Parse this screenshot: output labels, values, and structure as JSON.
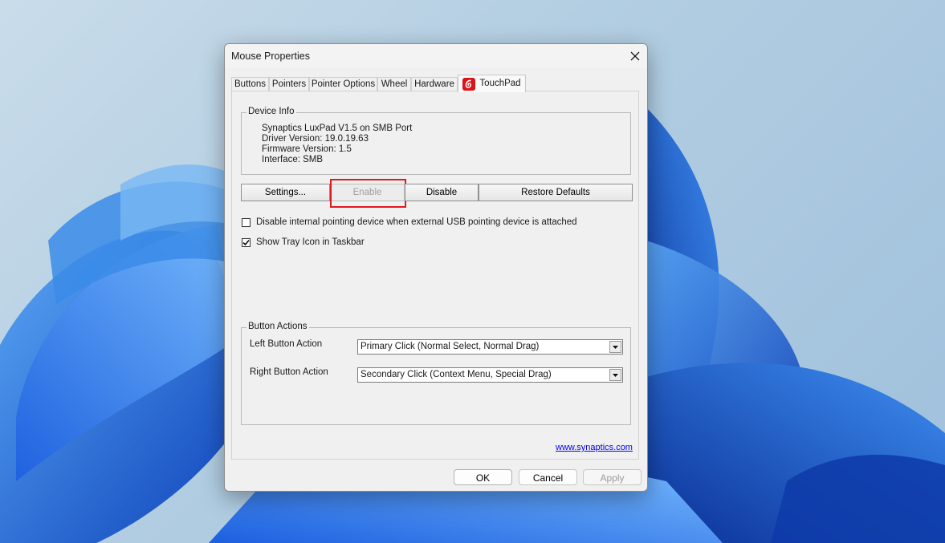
{
  "window": {
    "title": "Mouse Properties"
  },
  "tabs": [
    {
      "label": "Buttons"
    },
    {
      "label": "Pointers"
    },
    {
      "label": "Pointer Options"
    },
    {
      "label": "Wheel"
    },
    {
      "label": "Hardware"
    },
    {
      "label": "TouchPad",
      "active": true
    }
  ],
  "device_info": {
    "legend": "Device Info",
    "lines": [
      "Synaptics LuxPad V1.5 on SMB Port",
      "Driver Version: 19.0.19.63",
      "Firmware Version: 1.5",
      "Interface: SMB"
    ]
  },
  "actions": {
    "settings": "Settings...",
    "enable": "Enable",
    "disable": "Disable",
    "restore": "Restore Defaults"
  },
  "options": {
    "disable_internal": {
      "label": "Disable internal pointing device when external USB pointing device is attached",
      "checked": false
    },
    "show_tray": {
      "label": "Show Tray Icon in Taskbar",
      "checked": true
    }
  },
  "button_actions": {
    "legend": "Button Actions",
    "left_label": "Left Button Action",
    "left_value": "Primary Click (Normal Select, Normal Drag)",
    "right_label": "Right Button Action",
    "right_value": "Secondary Click (Context Menu, Special Drag)"
  },
  "link": "www.synaptics.com",
  "footer": {
    "ok": "OK",
    "cancel": "Cancel",
    "apply": "Apply"
  },
  "colors": {
    "highlight": "#e0191e",
    "synaptics_red": "#d7141a",
    "wallpaper_blue": "#1a56d6"
  }
}
